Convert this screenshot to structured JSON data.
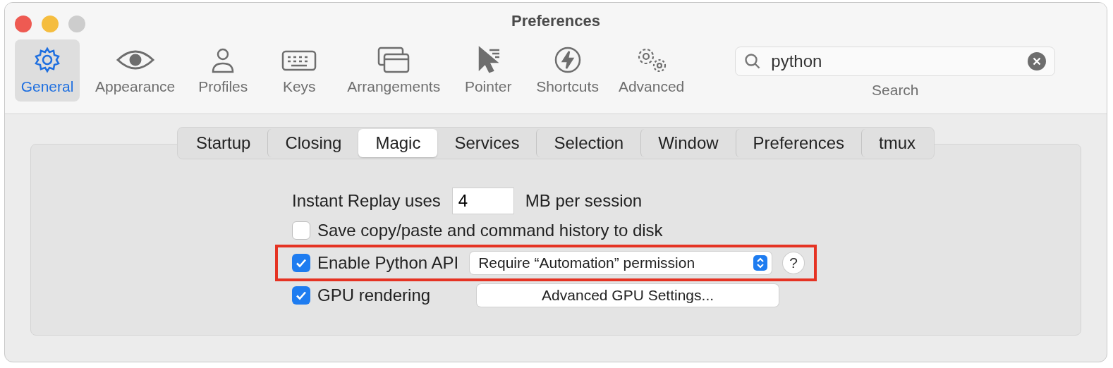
{
  "window": {
    "title": "Preferences"
  },
  "toolbar": [
    {
      "label": "General",
      "selected": true
    },
    {
      "label": "Appearance",
      "selected": false
    },
    {
      "label": "Profiles",
      "selected": false
    },
    {
      "label": "Keys",
      "selected": false
    },
    {
      "label": "Arrangements",
      "selected": false
    },
    {
      "label": "Pointer",
      "selected": false
    },
    {
      "label": "Shortcuts",
      "selected": false
    },
    {
      "label": "Advanced",
      "selected": false
    }
  ],
  "search": {
    "value": "python",
    "label": "Search"
  },
  "tabs": [
    {
      "label": "Startup",
      "selected": false
    },
    {
      "label": "Closing",
      "selected": false
    },
    {
      "label": "Magic",
      "selected": true
    },
    {
      "label": "Services",
      "selected": false
    },
    {
      "label": "Selection",
      "selected": false
    },
    {
      "label": "Window",
      "selected": false
    },
    {
      "label": "Preferences",
      "selected": false
    },
    {
      "label": "tmux",
      "selected": false
    }
  ],
  "rows": [
    {
      "kind": "field",
      "label": "Instant Replay uses",
      "value": "4",
      "suffix": "MB per session"
    },
    {
      "kind": "checkbox",
      "label": "Save copy/paste and command history to disk",
      "checked": false,
      "highlighted": false
    },
    {
      "kind": "checkbox",
      "label": "Enable Python API",
      "checked": true,
      "highlighted": true,
      "popup": "Require “Automation” permission",
      "help": "?"
    },
    {
      "kind": "checkbox",
      "label": "GPU rendering",
      "checked": true,
      "highlighted": false,
      "button": "Advanced GPU Settings..."
    }
  ]
}
